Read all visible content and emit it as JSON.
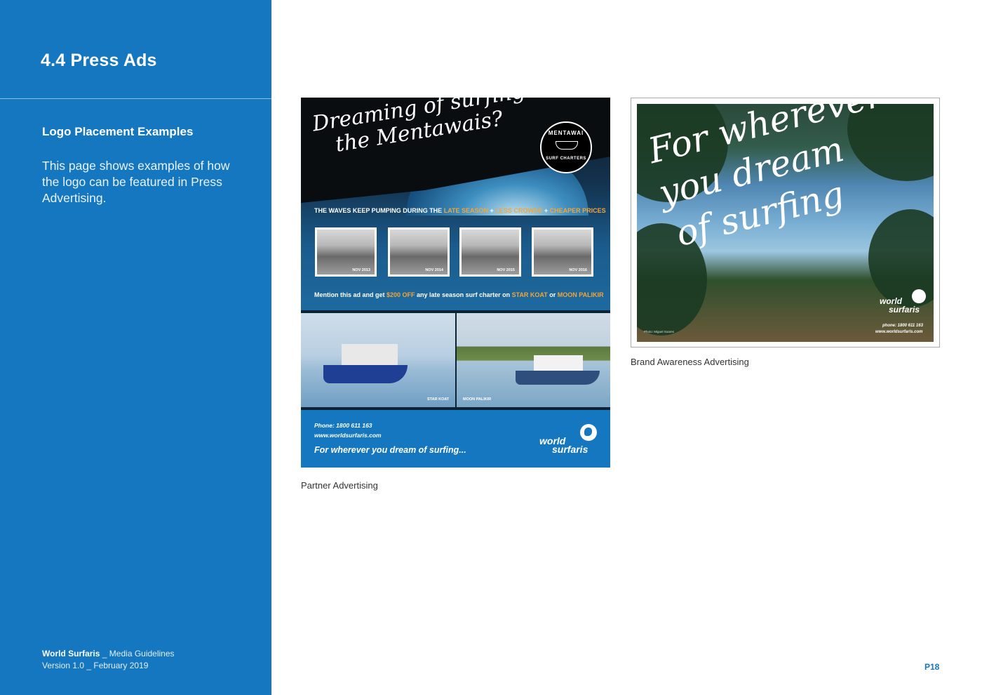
{
  "sidebar": {
    "section_title": "4.4  Press Ads",
    "subtitle": "Logo Placement Examples",
    "description": "This page shows examples of how the logo can be featured in Press Advertising.",
    "footer_brand": "World Surfaris",
    "footer_brand_suffix": " _ Media Guidelines",
    "footer_version": "Version 1.0 _ February 2019"
  },
  "page_number": "P18",
  "partner_ad": {
    "headline_line1": "Dreaming of surfing",
    "headline_line2": "the Mentawais?",
    "badge_top": "MENTAWAI",
    "badge_bottom": "SURF CHARTERS",
    "tagline_start": "THE WAVES KEEP PUMPING DURING THE ",
    "tagline_late": "LATE SEASON",
    "tagline_sep1": " + ",
    "tagline_crowds": "LESS CROWDS",
    "tagline_sep2": " + ",
    "tagline_prices": "CHEAPER PRICES",
    "thumbnails": [
      "NOV 2013",
      "NOV 2014",
      "NOV 2015",
      "NOV 2016"
    ],
    "mention_start": "Mention this ad and get ",
    "mention_offer": "$200 OFF",
    "mention_mid": " any late season surf charter on ",
    "mention_boat1": "STAR KOAT",
    "mention_or": " or ",
    "mention_boat2": "MOON PALIKIR",
    "boat1_label": "STAR KOAT",
    "boat2_label": "MOON PALIKIR",
    "phone": "Phone: 1800 611 163",
    "website": "www.worldsurfaris.com",
    "slogan": "For wherever you dream of surfing...",
    "logo_word1": "world",
    "logo_word2": "surfaris",
    "caption": "Partner Advertising"
  },
  "brand_ad": {
    "headline_line1": "For wherever",
    "headline_line2": "you dream",
    "headline_line3": "of surfing",
    "logo_word1": "world",
    "logo_word2": "surfaris",
    "phone": "phone: 1800 611 163",
    "website": "www.worldsurfaris.com",
    "photo_credit": "Photo: Miguel Soares",
    "caption": "Brand Awareness Advertising"
  },
  "colors": {
    "brand_blue": "#1477bf",
    "accent_orange": "#f3a53a"
  }
}
